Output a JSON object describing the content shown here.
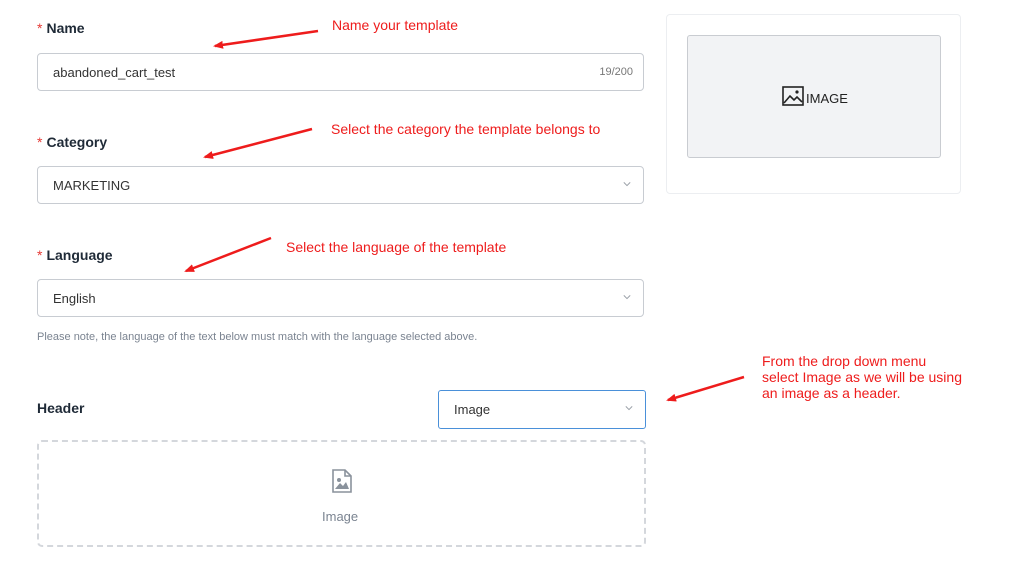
{
  "form": {
    "name": {
      "required_mark": "*",
      "label": "Name",
      "value": "abandoned_cart_test",
      "counter": "19/200"
    },
    "category": {
      "required_mark": "*",
      "label": "Category",
      "value": "MARKETING"
    },
    "language": {
      "required_mark": "*",
      "label": "Language",
      "value": "English",
      "note": "Please note, the language of the text below must match with the language selected above."
    },
    "header": {
      "label": "Header",
      "selected": "Image",
      "upload_label": "Image"
    }
  },
  "preview": {
    "text": "IMAGE"
  },
  "annotations": {
    "name": "Name your template",
    "category": "Select the category the template belongs to",
    "language": "Select the language of the template",
    "header_line1": "From the drop down menu",
    "header_line2": "select Image as we will be using",
    "header_line3": "an image as a header."
  },
  "colors": {
    "annotation": "#ee1c1c",
    "required": "#e53935",
    "focus_border": "#4a90d9"
  }
}
